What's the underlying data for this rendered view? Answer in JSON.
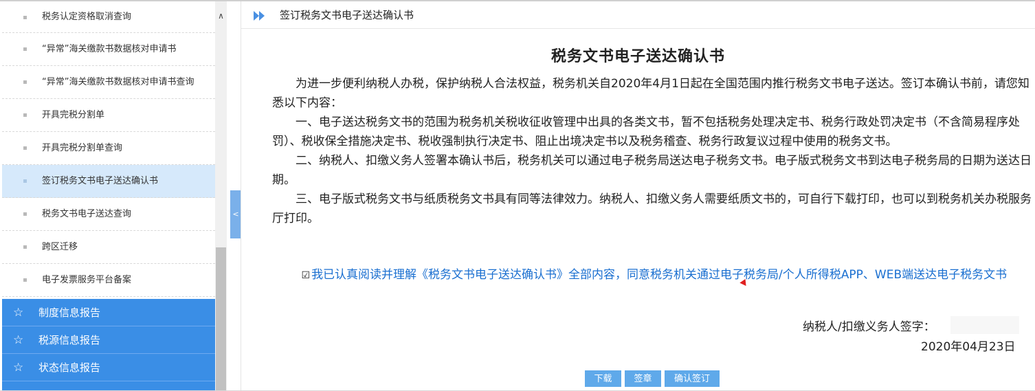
{
  "sidebar": {
    "items": [
      {
        "label": "税务认定资格取消查询"
      },
      {
        "label": "“异常”海关缴款书数据核对申请书"
      },
      {
        "label": "“异常”海关缴款书数据核对申请书查询"
      },
      {
        "label": "开具完税分割单"
      },
      {
        "label": "开具完税分割单查询"
      },
      {
        "label": "签订税务文书电子送达确认书"
      },
      {
        "label": "税务文书电子送达查询"
      },
      {
        "label": "跨区迁移"
      },
      {
        "label": "电子发票服务平台备案"
      }
    ],
    "active_index": 5,
    "categories": [
      {
        "label": "制度信息报告",
        "icon": "star-icon"
      },
      {
        "label": "税源信息报告",
        "icon": "star-icon"
      },
      {
        "label": "状态信息报告",
        "icon": "star-icon"
      }
    ],
    "collapse_symbol": "<",
    "scroll_up_symbol": "∧"
  },
  "header": {
    "title": "签订税务文书电子送达确认书",
    "icon": "double-chevron-right-icon"
  },
  "document": {
    "title": "税务文书电子送达确认书",
    "intro": "为进一步便利纳税人办税，保护纳税人合法权益，税务机关自2020年4月1日起在全国范围内推行税务文书电子送达。签订本确认书前，请您知悉以下内容：",
    "clause1": "一、电子送达税务文书的范围为税务机关税收征收管理中出具的各类文书，暂不包括税务处理决定书、税务行政处罚决定书（不含简易程序处罚）、税收保全措施决定书、税收强制执行决定书、阻止出境决定书以及税务稽查、税务行政复议过程中使用的税务文书。",
    "clause2": "二、纳税人、扣缴义务人签署本确认书后，税务机关可以通过电子税务局送达电子税务文书。电子版式税务文书到达电子税务局的日期为送达日期。",
    "clause3": "三、电子版式税务文书与纸质税务文书具有同等法律效力。纳税人、扣缴义务人需要纸质文书的，可自行下载打印，也可以到税务机关办税服务厅打印。"
  },
  "agreement": {
    "checkbox_symbol": "☑",
    "text": "我已认真阅读并理解《税务文书电子送达确认书》全部内容，同意税务机关通过电子税务局/个人所得税APP、WEB端送达电子税务文书"
  },
  "signature": {
    "label": "纳税人/扣缴义务人签字：",
    "date": "2020年04月23日"
  },
  "buttons": {
    "download": "下载",
    "seal": "签章",
    "confirm": "确认签订"
  },
  "colors": {
    "accent": "#3a8ee6",
    "link": "#1a6fd0",
    "active_row": "#d6e9fb",
    "button": "#5fa9ea"
  }
}
